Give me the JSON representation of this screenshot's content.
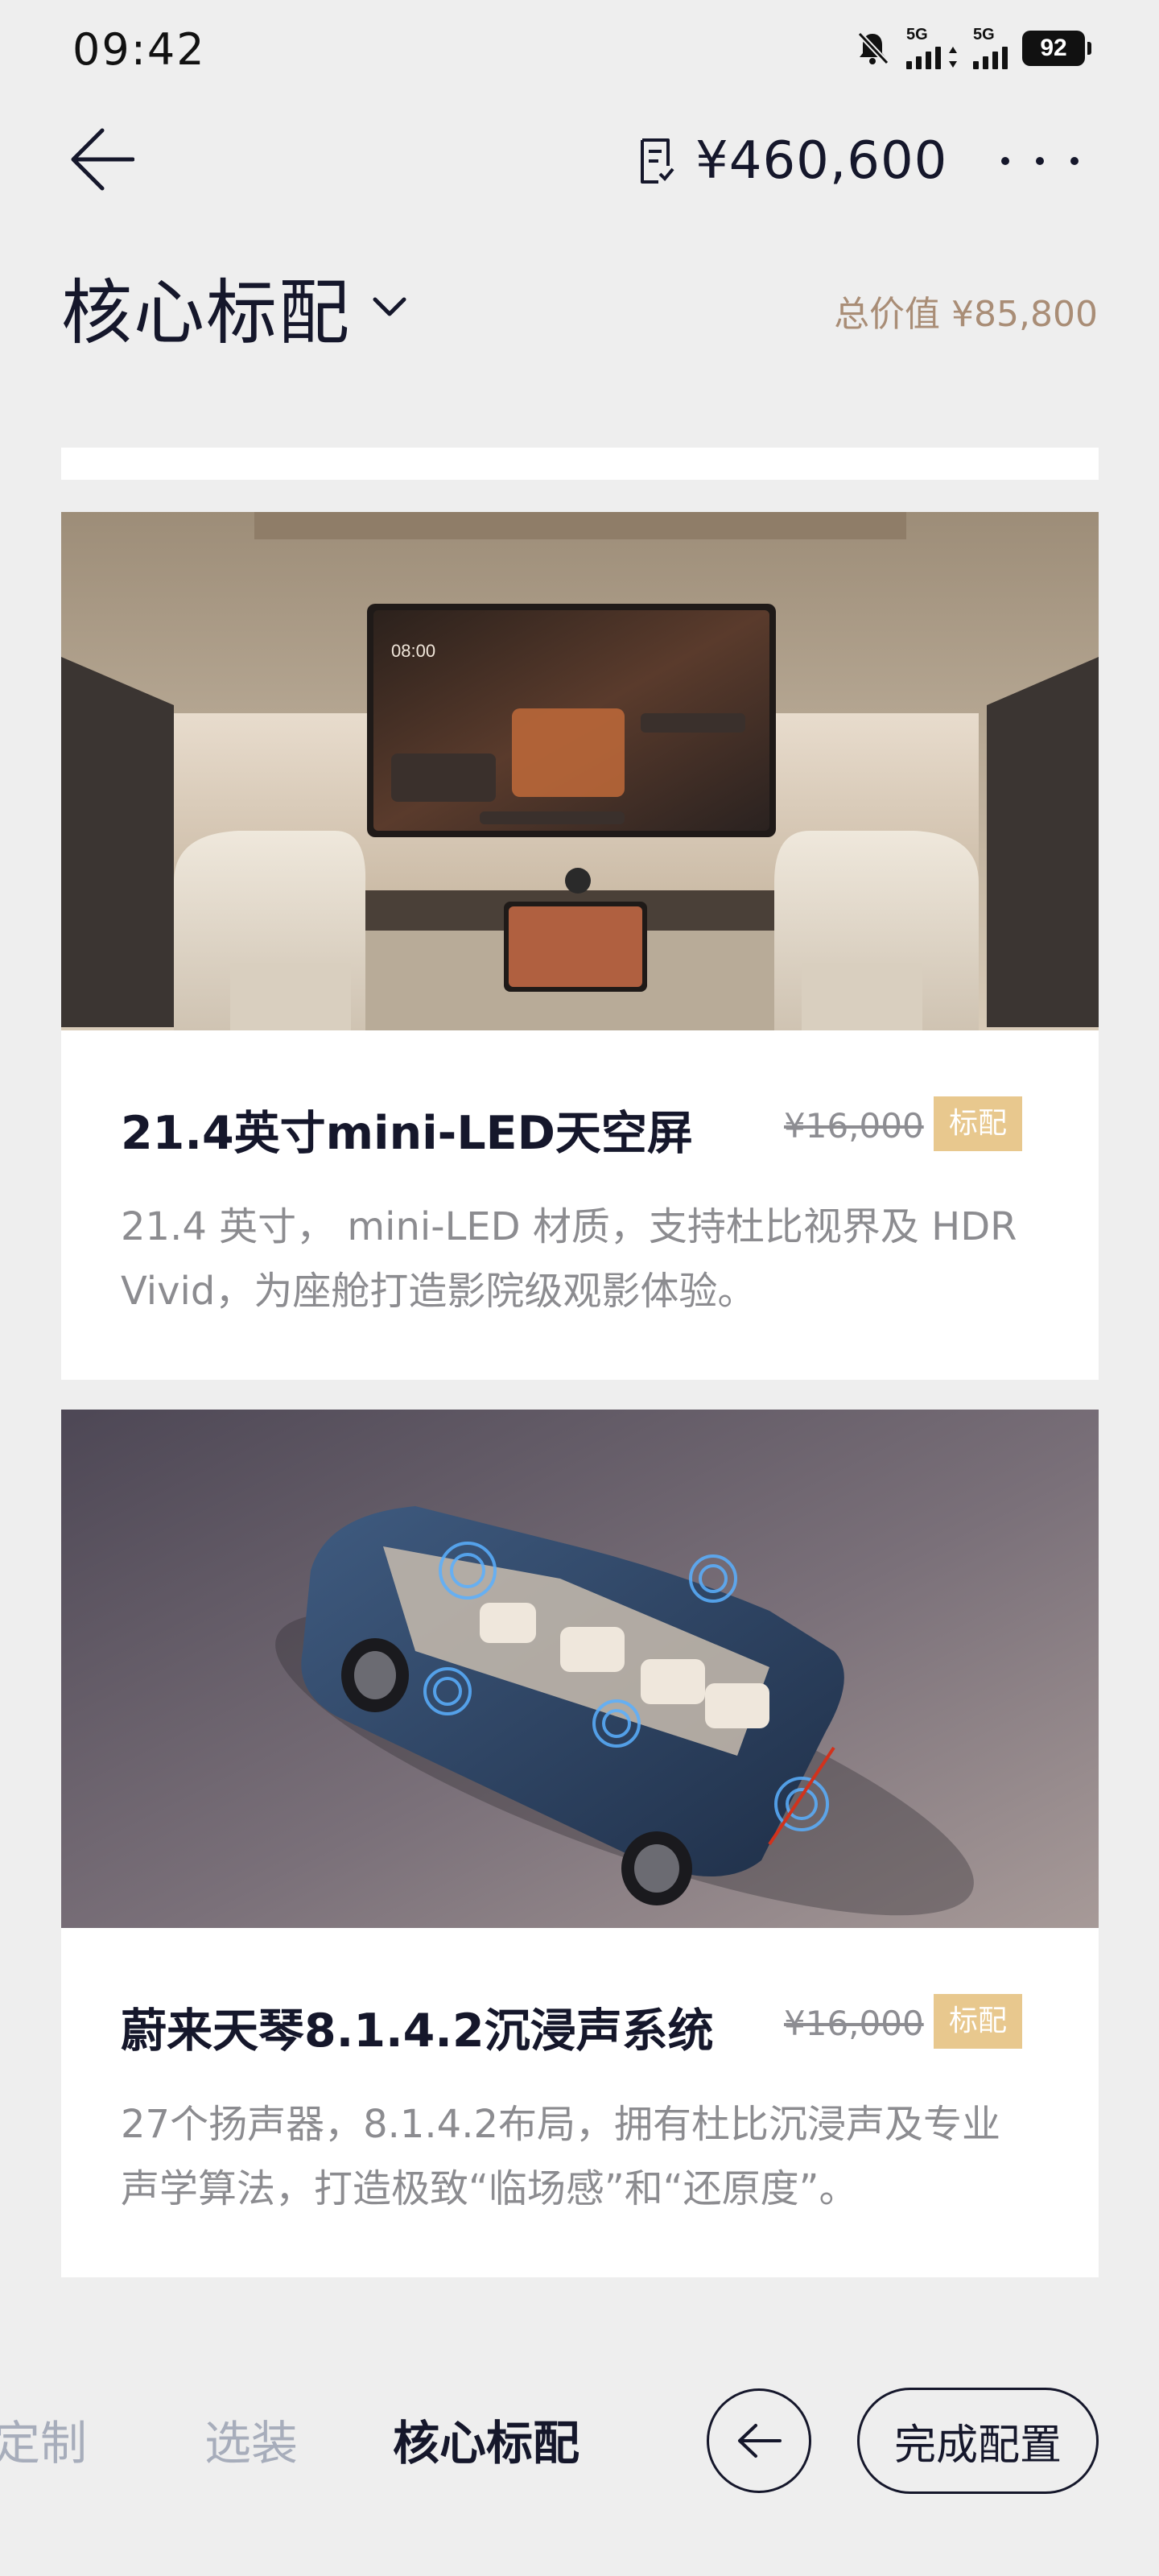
{
  "status_bar": {
    "time": "09:42",
    "network_1": "5G",
    "network_2": "5G",
    "battery": "92",
    "icons": [
      "bell-off-icon",
      "signal-icon",
      "signal-icon"
    ]
  },
  "header": {
    "price": "¥460,600",
    "icons": [
      "back-arrow-icon",
      "receipt-icon",
      "more-icon"
    ]
  },
  "section": {
    "title": "核心标配",
    "total_value": "总价值 ¥85,800",
    "icons": [
      "chevron-down-icon"
    ]
  },
  "cards": [
    {
      "title": "21.4英寸mini-LED天空屏",
      "old_price": "¥16,000",
      "badge": "标配",
      "description": "21.4 英寸， mini-LED 材质，支持杜比视界及 HDR Vivid，为座舱打造影院级观影体验。",
      "screen_time": "08:00"
    },
    {
      "title": "蔚来天琴8.1.4.2沉浸声系统",
      "old_price": "¥16,000",
      "badge": "标配",
      "description": "27个扬声器，8.1.4.2布局，拥有杜比沉浸声及专业声学算法，打造极致“临场感”和“还原度”。"
    }
  ],
  "bottom_bar": {
    "tabs": [
      "定制",
      "选装",
      "核心标配"
    ],
    "active_tab": 2,
    "finish_label": "完成配置",
    "icons": [
      "arrow-left-icon"
    ]
  },
  "colors": {
    "page_bg": "#eeeeee",
    "text_dark": "#15172b",
    "badge_gold": "#e8c88e",
    "total_value": "#a98d76",
    "muted_text": "#8c8c90",
    "tab_muted": "#a7adbb"
  }
}
